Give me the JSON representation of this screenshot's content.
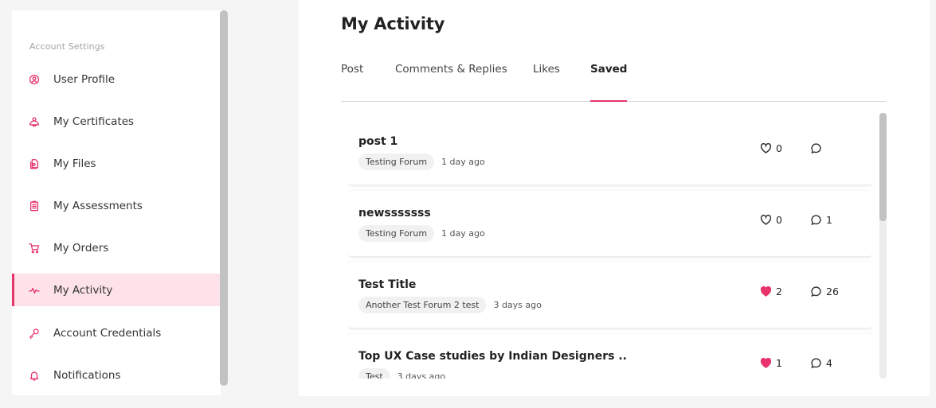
{
  "sidebar": {
    "heading": "Account Settings",
    "items": [
      {
        "label": "User Profile",
        "icon": "user-icon"
      },
      {
        "label": "My Certificates",
        "icon": "certificate-icon"
      },
      {
        "label": "My Files",
        "icon": "files-icon"
      },
      {
        "label": "My Assessments",
        "icon": "clipboard-icon"
      },
      {
        "label": "My Orders",
        "icon": "cart-icon"
      },
      {
        "label": "My Activity",
        "icon": "activity-icon",
        "active": true
      },
      {
        "label": "Account Credentials",
        "icon": "key-icon"
      },
      {
        "label": "Notifications",
        "icon": "bell-icon"
      }
    ]
  },
  "main": {
    "title": "My Activity",
    "tabs": [
      {
        "label": "Post"
      },
      {
        "label": "Comments & Replies"
      },
      {
        "label": "Likes"
      },
      {
        "label": "Saved",
        "active": true
      }
    ],
    "posts": [
      {
        "title": "post 1",
        "forum": "Testing Forum",
        "time": "1 day ago",
        "likes": "0",
        "liked": false,
        "comments": ""
      },
      {
        "title": "newsssssss",
        "forum": "Testing Forum",
        "time": "1 day ago",
        "likes": "0",
        "liked": false,
        "comments": "1"
      },
      {
        "title": "Test Title",
        "forum": "Another Test Forum 2 test",
        "time": "3 days ago",
        "likes": "2",
        "liked": true,
        "comments": "26"
      },
      {
        "title": "Top UX Case studies by Indian Designers ..",
        "forum": "Test",
        "time": "3 days ago",
        "likes": "1",
        "liked": true,
        "comments": "4"
      }
    ]
  },
  "colors": {
    "accent": "#e8346b",
    "active_bg": "#fde3e9"
  }
}
